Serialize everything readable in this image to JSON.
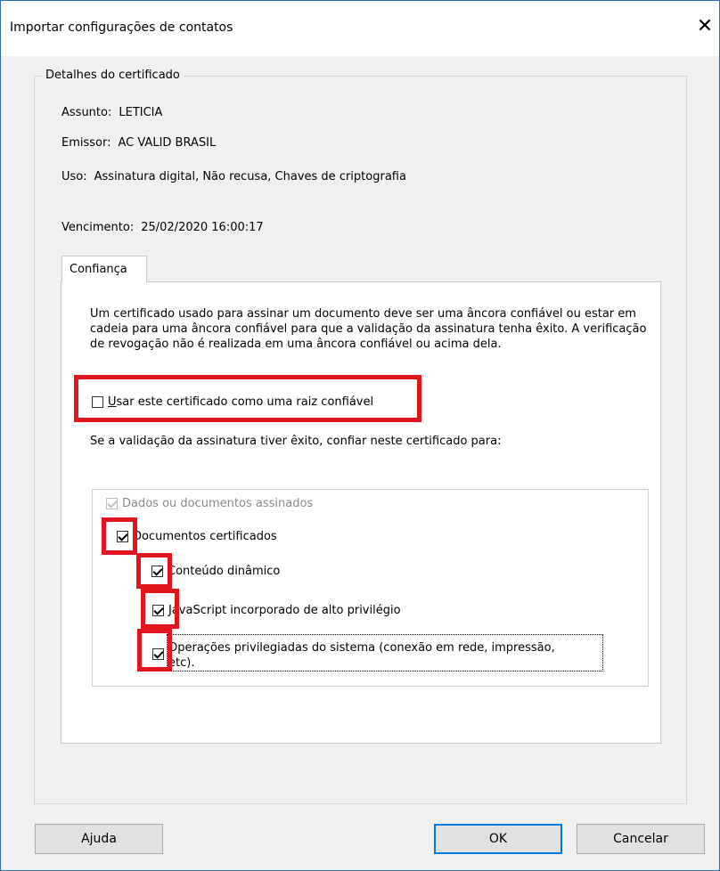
{
  "window": {
    "title": "Importar configurações de contatos",
    "close_glyph": "✕"
  },
  "details": {
    "legend": "Detalhes do certificado",
    "subject_label": "Assunto:",
    "subject_value": "LETICIA",
    "issuer_label": "Emissor:",
    "issuer_value": "AC VALID BRASIL",
    "usage_label": "Uso:",
    "usage_value": "Assinatura digital, Não recusa, Chaves de criptografia",
    "expiry_label": "Vencimento:",
    "expiry_value": "25/02/2020 16:00:17"
  },
  "tab": {
    "label": "Confiança"
  },
  "trust": {
    "description": "Um certificado usado para assinar um documento deve ser uma âncora confiável ou estar em cadeia para uma âncora confiável para que a validação da assinatura tenha êxito. A verificação de revogação não é realizada em uma âncora confiável ou acima dela.",
    "root_checkbox_label_first": "U",
    "root_checkbox_label_rest": "sar este certificado como uma raiz confiável",
    "root_checked": false,
    "if_valid_text": "Se a validação da assinatura tiver êxito, confiar neste certificado para:"
  },
  "tree": {
    "items": [
      {
        "label": "Dados ou documentos assinados",
        "checked": true,
        "disabled": true
      },
      {
        "label": "Documentos certificados",
        "checked": true,
        "disabled": false
      },
      {
        "label": "Conteúdo dinâmico",
        "checked": true,
        "disabled": false
      },
      {
        "label": "JavaScript incorporado de alto privilégio",
        "checked": true,
        "disabled": false
      },
      {
        "label_line1": "Operações privilegiadas do sistema (conexão em rede, impressão,",
        "label_line2": "etc).",
        "checked": true,
        "disabled": false
      }
    ]
  },
  "buttons": {
    "help": "Ajuda",
    "ok": "OK",
    "cancel": "Cancelar"
  },
  "colors": {
    "accent": "#0078d7",
    "highlight": "#e2141e"
  }
}
